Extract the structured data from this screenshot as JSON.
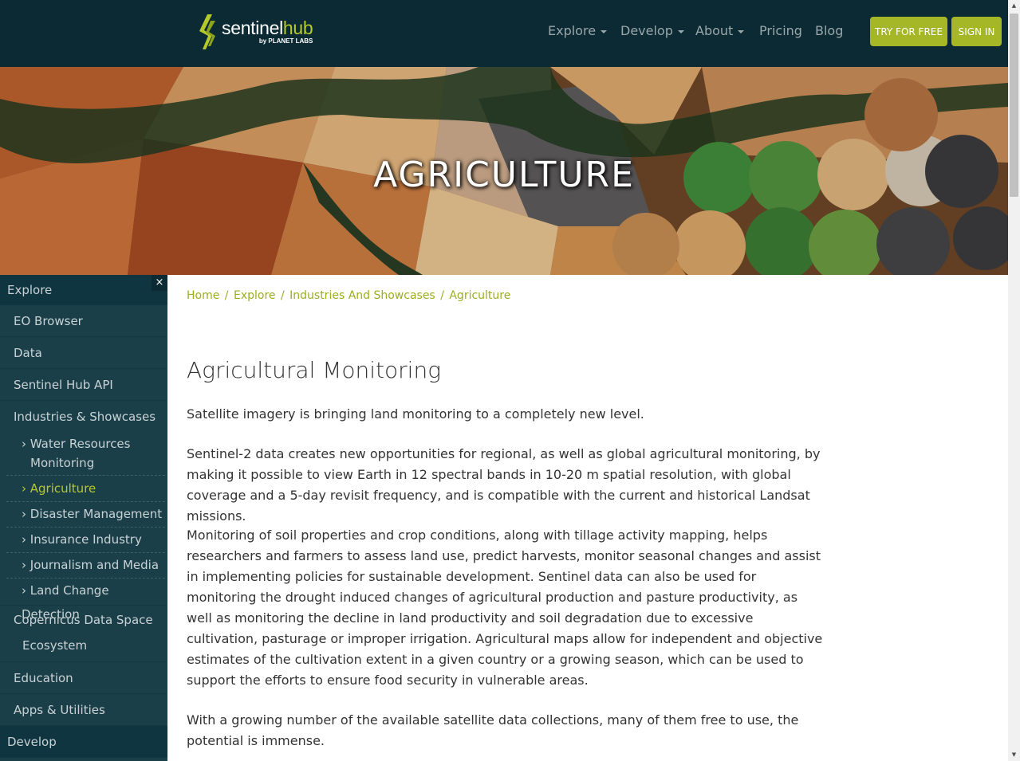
{
  "header": {
    "logo": {
      "word_main": "sentinel",
      "word_accent": "hub",
      "by": "by PLANET LABS"
    },
    "nav": [
      {
        "label": "Explore",
        "dropdown": true
      },
      {
        "label": "Develop",
        "dropdown": true
      },
      {
        "label": "About",
        "dropdown": true
      },
      {
        "label": "Pricing",
        "dropdown": false
      },
      {
        "label": "Blog",
        "dropdown": false
      }
    ],
    "try_button": "TRY FOR FREE",
    "signin_button": "SIGN IN"
  },
  "hero": {
    "title": "AGRICULTURE"
  },
  "sidebar": {
    "close_label": "×",
    "top_explore": "Explore",
    "items": [
      {
        "label": "EO Browser"
      },
      {
        "label": "Data"
      },
      {
        "label": "Sentinel Hub API"
      },
      {
        "label": "Industries & Showcases"
      }
    ],
    "sub_items": [
      {
        "line1": "› Water Resources",
        "line2": "Monitoring"
      },
      {
        "label": "› Agriculture",
        "active": true
      },
      {
        "label": "› Disaster Management"
      },
      {
        "label": "› Insurance Industry"
      },
      {
        "label": "› Journalism and Media"
      },
      {
        "label": "› Land Change Detection"
      }
    ],
    "items_after": [
      {
        "line1": "Copernicus Data Space",
        "line2": "Ecosystem"
      },
      {
        "label": "Education"
      },
      {
        "label": "Apps & Utilities"
      }
    ],
    "top_develop": "Develop",
    "colors": {
      "active": "#b5c92b",
      "background": "#1b3f49"
    }
  },
  "breadcrumb": {
    "items": [
      "Home",
      "Explore",
      "Industries And Showcases",
      "Agriculture"
    ],
    "separator": "/"
  },
  "content": {
    "title": "Agricultural Monitoring",
    "paragraphs": [
      "Satellite imagery is bringing land monitoring to a completely new level.",
      "Sentinel-2 data creates new opportunities for regional, as well as global agricultural monitoring, by making it possible to view Earth in 12 spectral bands in 10-20 m spatial resolution, with global coverage and a 5-day revisit frequency, and is compatible with the current and historical Landsat missions.",
      "Monitoring of soil properties and crop conditions, along with tillage activity mapping, helps researchers and farmers to assess land use, predict harvests, monitor seasonal changes and assist in implementing policies for sustainable development. Sentinel data can also be used for monitoring the drought induced changes of agricultural production and pasture productivity, as well as monitoring the decline in land productivity and soil degradation due to excessive cultivation, pasturage or improper irrigation. Agricultural maps allow for independent and objective estimates of the cultivation extent in a given country or a growing season, which can be used to support the efforts to ensure food security in vulnerable areas.",
      "With a growing number of the available satellite data collections, many of them free to use, the potential is immense."
    ]
  },
  "colors": {
    "navbar": "#0b2a33",
    "accent": "#a5b726",
    "link": "#9aae1f"
  }
}
